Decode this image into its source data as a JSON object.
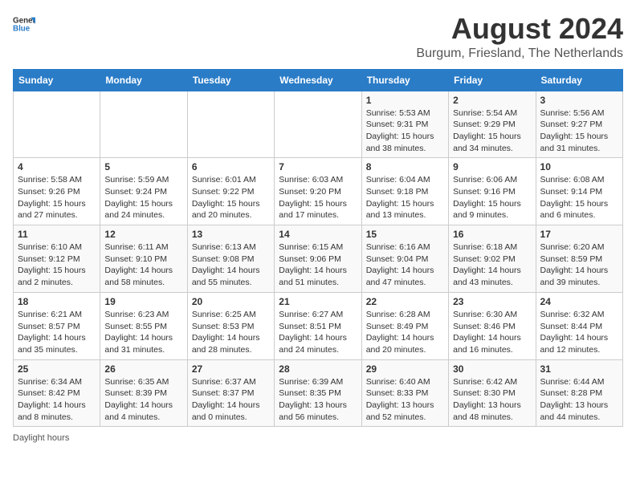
{
  "logo": {
    "text_general": "General",
    "text_blue": "Blue"
  },
  "title": "August 2024",
  "subtitle": "Burgum, Friesland, The Netherlands",
  "days_of_week": [
    "Sunday",
    "Monday",
    "Tuesday",
    "Wednesday",
    "Thursday",
    "Friday",
    "Saturday"
  ],
  "weeks": [
    [
      {
        "day": "",
        "detail": ""
      },
      {
        "day": "",
        "detail": ""
      },
      {
        "day": "",
        "detail": ""
      },
      {
        "day": "",
        "detail": ""
      },
      {
        "day": "1",
        "detail": "Sunrise: 5:53 AM\nSunset: 9:31 PM\nDaylight: 15 hours\nand 38 minutes."
      },
      {
        "day": "2",
        "detail": "Sunrise: 5:54 AM\nSunset: 9:29 PM\nDaylight: 15 hours\nand 34 minutes."
      },
      {
        "day": "3",
        "detail": "Sunrise: 5:56 AM\nSunset: 9:27 PM\nDaylight: 15 hours\nand 31 minutes."
      }
    ],
    [
      {
        "day": "4",
        "detail": "Sunrise: 5:58 AM\nSunset: 9:26 PM\nDaylight: 15 hours\nand 27 minutes."
      },
      {
        "day": "5",
        "detail": "Sunrise: 5:59 AM\nSunset: 9:24 PM\nDaylight: 15 hours\nand 24 minutes."
      },
      {
        "day": "6",
        "detail": "Sunrise: 6:01 AM\nSunset: 9:22 PM\nDaylight: 15 hours\nand 20 minutes."
      },
      {
        "day": "7",
        "detail": "Sunrise: 6:03 AM\nSunset: 9:20 PM\nDaylight: 15 hours\nand 17 minutes."
      },
      {
        "day": "8",
        "detail": "Sunrise: 6:04 AM\nSunset: 9:18 PM\nDaylight: 15 hours\nand 13 minutes."
      },
      {
        "day": "9",
        "detail": "Sunrise: 6:06 AM\nSunset: 9:16 PM\nDaylight: 15 hours\nand 9 minutes."
      },
      {
        "day": "10",
        "detail": "Sunrise: 6:08 AM\nSunset: 9:14 PM\nDaylight: 15 hours\nand 6 minutes."
      }
    ],
    [
      {
        "day": "11",
        "detail": "Sunrise: 6:10 AM\nSunset: 9:12 PM\nDaylight: 15 hours\nand 2 minutes."
      },
      {
        "day": "12",
        "detail": "Sunrise: 6:11 AM\nSunset: 9:10 PM\nDaylight: 14 hours\nand 58 minutes."
      },
      {
        "day": "13",
        "detail": "Sunrise: 6:13 AM\nSunset: 9:08 PM\nDaylight: 14 hours\nand 55 minutes."
      },
      {
        "day": "14",
        "detail": "Sunrise: 6:15 AM\nSunset: 9:06 PM\nDaylight: 14 hours\nand 51 minutes."
      },
      {
        "day": "15",
        "detail": "Sunrise: 6:16 AM\nSunset: 9:04 PM\nDaylight: 14 hours\nand 47 minutes."
      },
      {
        "day": "16",
        "detail": "Sunrise: 6:18 AM\nSunset: 9:02 PM\nDaylight: 14 hours\nand 43 minutes."
      },
      {
        "day": "17",
        "detail": "Sunrise: 6:20 AM\nSunset: 8:59 PM\nDaylight: 14 hours\nand 39 minutes."
      }
    ],
    [
      {
        "day": "18",
        "detail": "Sunrise: 6:21 AM\nSunset: 8:57 PM\nDaylight: 14 hours\nand 35 minutes."
      },
      {
        "day": "19",
        "detail": "Sunrise: 6:23 AM\nSunset: 8:55 PM\nDaylight: 14 hours\nand 31 minutes."
      },
      {
        "day": "20",
        "detail": "Sunrise: 6:25 AM\nSunset: 8:53 PM\nDaylight: 14 hours\nand 28 minutes."
      },
      {
        "day": "21",
        "detail": "Sunrise: 6:27 AM\nSunset: 8:51 PM\nDaylight: 14 hours\nand 24 minutes."
      },
      {
        "day": "22",
        "detail": "Sunrise: 6:28 AM\nSunset: 8:49 PM\nDaylight: 14 hours\nand 20 minutes."
      },
      {
        "day": "23",
        "detail": "Sunrise: 6:30 AM\nSunset: 8:46 PM\nDaylight: 14 hours\nand 16 minutes."
      },
      {
        "day": "24",
        "detail": "Sunrise: 6:32 AM\nSunset: 8:44 PM\nDaylight: 14 hours\nand 12 minutes."
      }
    ],
    [
      {
        "day": "25",
        "detail": "Sunrise: 6:34 AM\nSunset: 8:42 PM\nDaylight: 14 hours\nand 8 minutes."
      },
      {
        "day": "26",
        "detail": "Sunrise: 6:35 AM\nSunset: 8:39 PM\nDaylight: 14 hours\nand 4 minutes."
      },
      {
        "day": "27",
        "detail": "Sunrise: 6:37 AM\nSunset: 8:37 PM\nDaylight: 14 hours\nand 0 minutes."
      },
      {
        "day": "28",
        "detail": "Sunrise: 6:39 AM\nSunset: 8:35 PM\nDaylight: 13 hours\nand 56 minutes."
      },
      {
        "day": "29",
        "detail": "Sunrise: 6:40 AM\nSunset: 8:33 PM\nDaylight: 13 hours\nand 52 minutes."
      },
      {
        "day": "30",
        "detail": "Sunrise: 6:42 AM\nSunset: 8:30 PM\nDaylight: 13 hours\nand 48 minutes."
      },
      {
        "day": "31",
        "detail": "Sunrise: 6:44 AM\nSunset: 8:28 PM\nDaylight: 13 hours\nand 44 minutes."
      }
    ]
  ],
  "footer": "Daylight hours"
}
